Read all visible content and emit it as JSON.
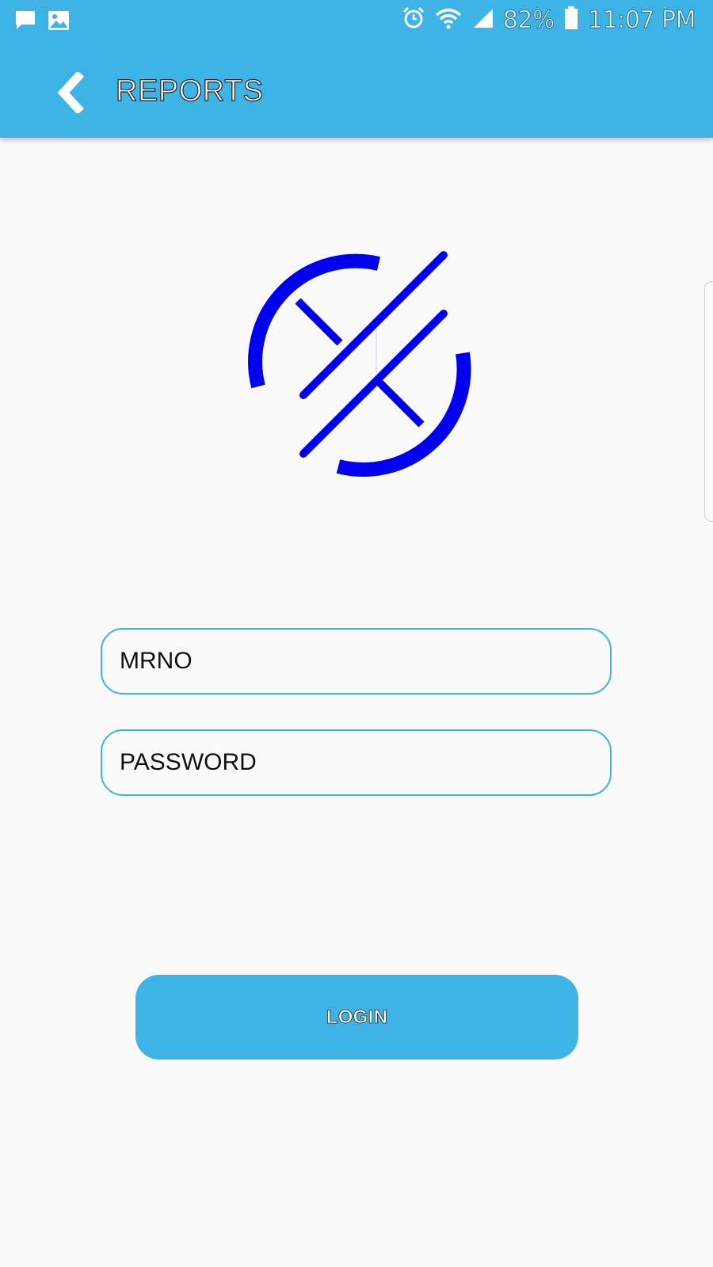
{
  "status_bar": {
    "battery_percent": "82%",
    "time": "11:07 PM",
    "icons": [
      "chat-icon",
      "image-icon",
      "alarm-icon",
      "wifi-icon",
      "signal-icon",
      "battery-icon"
    ]
  },
  "toolbar": {
    "back_icon": "chevron-left-icon",
    "title": "REPORTS"
  },
  "form": {
    "mrno_placeholder": "MRNO",
    "password_placeholder": "PASSWORD",
    "login_label": "LOGIN"
  },
  "colors": {
    "header": "#3db3e6",
    "field_border": "#3db3e6",
    "button": "#3db3e6",
    "logo": "#0000ee",
    "background": "#fafafa"
  }
}
